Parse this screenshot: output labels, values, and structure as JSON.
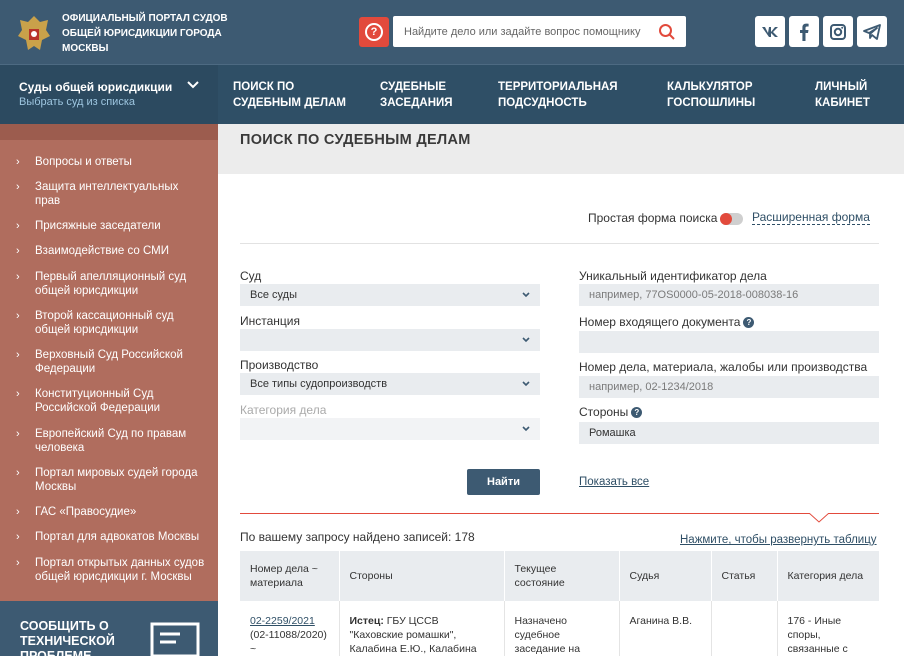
{
  "header": {
    "portal_title": "Официальный портал судов общей юрисдикции города Москвы",
    "search_placeholder": "Найдите дело или задайте вопрос помощнику",
    "social": [
      "vk",
      "facebook",
      "instagram",
      "telegram"
    ]
  },
  "court_select": {
    "title": "Суды общей юрисдикции",
    "subtitle": "Выбрать суд из списка"
  },
  "nav": [
    {
      "label": "Поиск по\nсудебным делам"
    },
    {
      "label": "Судебные\nзаседания"
    },
    {
      "label": "Территориальная\nподсудность"
    },
    {
      "label": "Калькулятор\nгоспошлины"
    },
    {
      "label": "Личный\nкабинет"
    }
  ],
  "sidebar": {
    "items": [
      "Вопросы и ответы",
      "Защита интеллектуальных прав",
      "Присяжные заседатели",
      "Взаимодействие со СМИ",
      "Первый апелляционный суд общей юрисдикции",
      "Второй кассационный суд общей юрисдикции",
      "Верховный Суд Российской Федерации",
      "Конституционный Суд Российской Федерации",
      "Европейский Суд по правам человека",
      "Портал мировых судей города Москвы",
      "ГАС «Правосудие»",
      "Портал для адвокатов Москвы",
      "Портал открытых данных судов общей юрисдикции г. Москвы"
    ],
    "report_label": "Сообщить о технической проблеме"
  },
  "page": {
    "title": "Поиск по судебным делам",
    "simple_form_label": "Простая форма поиска",
    "extended_form_link": "Расширенная форма"
  },
  "form": {
    "court_label": "Суд",
    "court_value": "Все суды",
    "instance_label": "Инстанция",
    "instance_value": "",
    "proceeding_label": "Производство",
    "proceeding_value": "Все типы судопроизводств",
    "category_label": "Категория дела",
    "category_value": "",
    "uid_label": "Уникальный идентификатор дела",
    "uid_placeholder": "например, 77OS0000-05-2018-008038-16",
    "incoming_label": "Номер входящего документа",
    "incoming_value": "",
    "case_number_label": "Номер дела, материала, жалобы или производства",
    "case_number_placeholder": "например, 02-1234/2018",
    "parties_label": "Стороны",
    "parties_value": "Ромашка",
    "find_button": "Найти",
    "show_all_link": "Показать все"
  },
  "results": {
    "found_text": "По вашему запросу найдено записей: 178",
    "expand_link": "Нажмите, чтобы развернуть таблицу",
    "columns": [
      "Номер дела ~ материала",
      "Стороны",
      "Текущее состояние",
      "Судья",
      "Статья",
      "Категория дела"
    ],
    "rows": [
      {
        "case_link": "02-2259/2021",
        "case_extra": "(02-11088/2020) ~",
        "parties_prefix": "Истец:",
        "parties_text": " ГБУ ЦССВ \"Каховские ромашки\", Калабина Е.Ю., Калабина Т.Ю.",
        "state": "Назначено судебное заседание на",
        "judge": "Аганина В.В.",
        "article": "",
        "category": "176 - Иные споры, связанные с"
      }
    ]
  }
}
